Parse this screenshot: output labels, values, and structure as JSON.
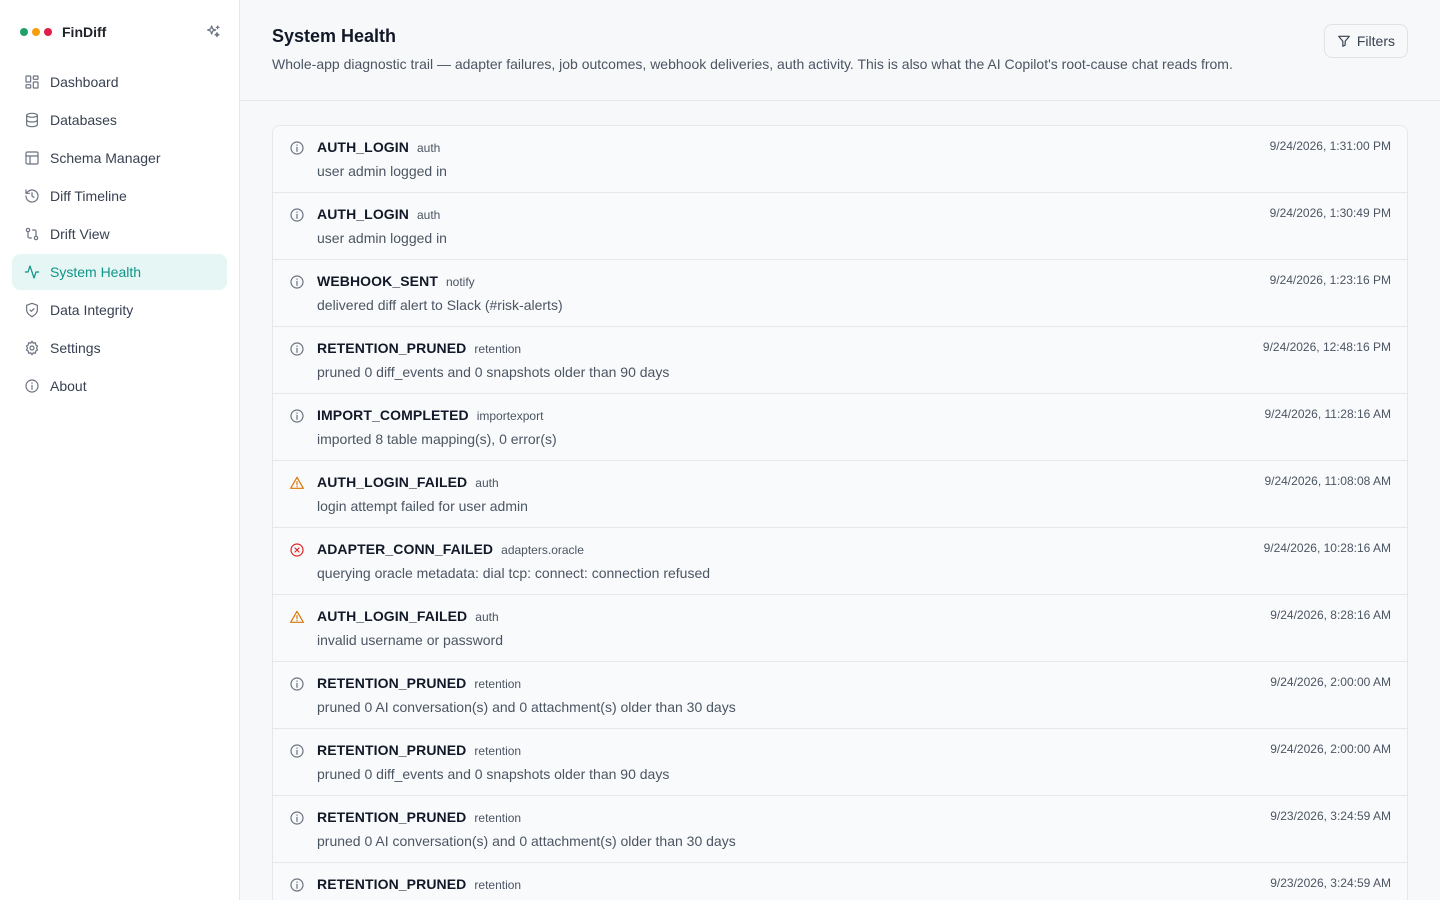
{
  "app": {
    "name": "FinDiff",
    "dot_colors": [
      "#22a06b",
      "#f59e0b",
      "#e11d48"
    ]
  },
  "sidebar": {
    "items": [
      {
        "label": "Dashboard",
        "icon": "dashboard-icon",
        "active": false
      },
      {
        "label": "Databases",
        "icon": "database-icon",
        "active": false
      },
      {
        "label": "Schema Manager",
        "icon": "table-icon",
        "active": false
      },
      {
        "label": "Diff Timeline",
        "icon": "history-icon",
        "active": false
      },
      {
        "label": "Drift View",
        "icon": "git-compare-icon",
        "active": false
      },
      {
        "label": "System Health",
        "icon": "activity-icon",
        "active": true
      },
      {
        "label": "Data Integrity",
        "icon": "shield-check-icon",
        "active": false
      },
      {
        "label": "Settings",
        "icon": "gear-icon",
        "active": false
      },
      {
        "label": "About",
        "icon": "info-icon",
        "active": false
      }
    ]
  },
  "header": {
    "title": "System Health",
    "description": "Whole-app diagnostic trail — adapter failures, job outcomes, webhook deliveries, auth activity. This is also what the AI Copilot's root-cause chat reads from.",
    "filters_label": "Filters"
  },
  "colors": {
    "accent": "#0f9488",
    "info": "#6b7280",
    "warning": "#d97706",
    "error": "#dc2626"
  },
  "events": [
    {
      "code": "AUTH_LOGIN",
      "category": "auth",
      "message": "user admin logged in",
      "time": "9/24/2026, 1:31:00 PM",
      "severity": "info"
    },
    {
      "code": "AUTH_LOGIN",
      "category": "auth",
      "message": "user admin logged in",
      "time": "9/24/2026, 1:30:49 PM",
      "severity": "info"
    },
    {
      "code": "WEBHOOK_SENT",
      "category": "notify",
      "message": "delivered diff alert to Slack (#risk-alerts)",
      "time": "9/24/2026, 1:23:16 PM",
      "severity": "info"
    },
    {
      "code": "RETENTION_PRUNED",
      "category": "retention",
      "message": "pruned 0 diff_events and 0 snapshots older than 90 days",
      "time": "9/24/2026, 12:48:16 PM",
      "severity": "info"
    },
    {
      "code": "IMPORT_COMPLETED",
      "category": "importexport",
      "message": "imported 8 table mapping(s), 0 error(s)",
      "time": "9/24/2026, 11:28:16 AM",
      "severity": "info"
    },
    {
      "code": "AUTH_LOGIN_FAILED",
      "category": "auth",
      "message": "login attempt failed for user admin",
      "time": "9/24/2026, 11:08:08 AM",
      "severity": "warning"
    },
    {
      "code": "ADAPTER_CONN_FAILED",
      "category": "adapters.oracle",
      "message": "querying oracle metadata: dial tcp: connect: connection refused",
      "time": "9/24/2026, 10:28:16 AM",
      "severity": "error"
    },
    {
      "code": "AUTH_LOGIN_FAILED",
      "category": "auth",
      "message": "invalid username or password",
      "time": "9/24/2026, 8:28:16 AM",
      "severity": "warning"
    },
    {
      "code": "RETENTION_PRUNED",
      "category": "retention",
      "message": "pruned 0 AI conversation(s) and 0 attachment(s) older than 30 days",
      "time": "9/24/2026, 2:00:00 AM",
      "severity": "info"
    },
    {
      "code": "RETENTION_PRUNED",
      "category": "retention",
      "message": "pruned 0 diff_events and 0 snapshots older than 90 days",
      "time": "9/24/2026, 2:00:00 AM",
      "severity": "info"
    },
    {
      "code": "RETENTION_PRUNED",
      "category": "retention",
      "message": "pruned 0 AI conversation(s) and 0 attachment(s) older than 30 days",
      "time": "9/23/2026, 3:24:59 AM",
      "severity": "info"
    },
    {
      "code": "RETENTION_PRUNED",
      "category": "retention",
      "message": "",
      "time": "9/23/2026, 3:24:59 AM",
      "severity": "info"
    }
  ]
}
